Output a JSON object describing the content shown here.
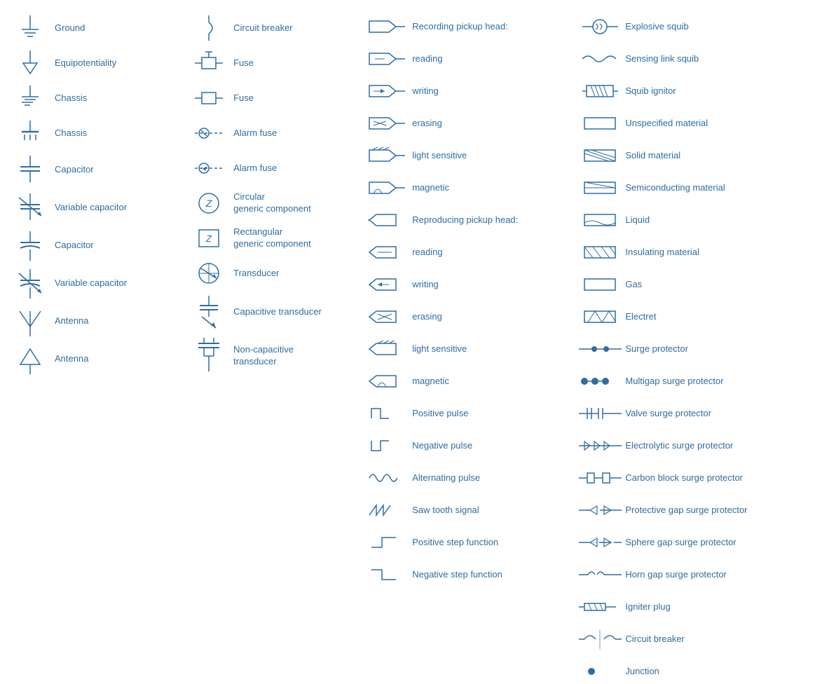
{
  "col1": [
    {
      "label": "Ground"
    },
    {
      "label": "Equipotentiality"
    },
    {
      "label": "Chassis"
    },
    {
      "label": "Chassis"
    },
    {
      "label": "Capacitor"
    },
    {
      "label": "Variable capacitor"
    },
    {
      "label": "Capacitor"
    },
    {
      "label": "Variable capacitor"
    },
    {
      "label": "Antenna"
    },
    {
      "label": "Antenna"
    }
  ],
  "col2": [
    {
      "label": "Circuit breaker"
    },
    {
      "label": "Fuse"
    },
    {
      "label": "Fuse"
    },
    {
      "label": "Alarm fuse"
    },
    {
      "label": "Alarm fuse"
    },
    {
      "label": "Circular\ngeneric component"
    },
    {
      "label": "Rectangular\ngeneric component"
    },
    {
      "label": "Transducer"
    },
    {
      "label": "Capacitive transducer"
    },
    {
      "label": "Non-capacitive\ntransducer"
    }
  ],
  "col3": [
    {
      "label": "Recording pickup head:"
    },
    {
      "label": "reading"
    },
    {
      "label": "writing"
    },
    {
      "label": "erasing"
    },
    {
      "label": "light sensitive"
    },
    {
      "label": "magnetic"
    },
    {
      "label": "Reproducing pickup head:"
    },
    {
      "label": "reading"
    },
    {
      "label": "writing"
    },
    {
      "label": "erasing"
    },
    {
      "label": "light sensitive"
    },
    {
      "label": "magnetic"
    },
    {
      "label": "Positive pulse"
    },
    {
      "label": "Negative pulse"
    },
    {
      "label": "Alternating pulse"
    },
    {
      "label": "Saw tooth signal"
    },
    {
      "label": "Positive step function"
    },
    {
      "label": "Negative step function"
    }
  ],
  "col4": [
    {
      "label": "Explosive squib"
    },
    {
      "label": "Sensing link squib"
    },
    {
      "label": "Squib ignitor"
    },
    {
      "label": "Unspecified material"
    },
    {
      "label": "Solid material"
    },
    {
      "label": "Semiconducting material"
    },
    {
      "label": "Liquid"
    },
    {
      "label": "Insulating material"
    },
    {
      "label": "Gas"
    },
    {
      "label": "Electret"
    },
    {
      "label": "Surge protector"
    },
    {
      "label": "Multigap surge protector"
    },
    {
      "label": "Valve surge protector"
    },
    {
      "label": "Electrolytic surge protector"
    },
    {
      "label": "Carbon block surge protector"
    },
    {
      "label": "Protective gap surge protector"
    },
    {
      "label": "Sphere gap surge protector"
    },
    {
      "label": "Horn gap surge protector"
    },
    {
      "label": "Igniter plug"
    },
    {
      "label": "Circuit breaker"
    },
    {
      "label": "Junction"
    }
  ]
}
